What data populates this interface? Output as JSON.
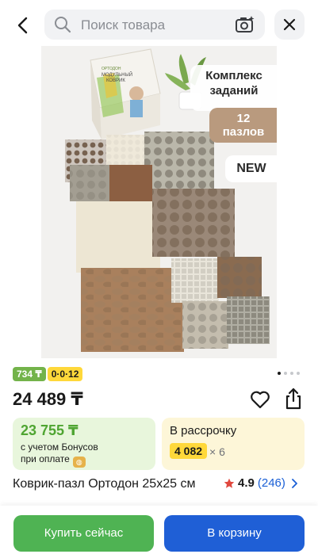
{
  "header": {
    "search_placeholder": "Поиск товара"
  },
  "image": {
    "badge_kompleks_line1": "Комплекс",
    "badge_kompleks_line2": "заданий",
    "badge_count": "12",
    "badge_count_label": "пазлов",
    "badge_new": "NEW",
    "box_brand": "ОРТОДОН",
    "box_line1": "МОДУЛЬНЫЙ",
    "box_line2": "КОВРИК",
    "total_images": 4,
    "active_image": 1
  },
  "tags": {
    "green": "734 ₸",
    "yellow": "0·0·12"
  },
  "price": "24 489 ₸",
  "bonus_card": {
    "price": "23 755 ₸",
    "line1": "с учетом Бонусов",
    "line2": "при оплате"
  },
  "installment_card": {
    "label": "В рассрочку",
    "amount": "4 082",
    "multiplier": "× 6"
  },
  "product": {
    "title": "Коврик-пазл Ортодон 25х25 см",
    "rating": "4.9",
    "reviews": "(246)"
  },
  "buttons": {
    "buy_now": "Купить сейчас",
    "add_to_cart": "В корзину"
  },
  "colors": {
    "green_button": "#4fb353",
    "blue_button": "#1f5fd6",
    "bonus_green": "#4fa532",
    "installment_yellow": "#ffd83a",
    "star": "#e0483e"
  }
}
